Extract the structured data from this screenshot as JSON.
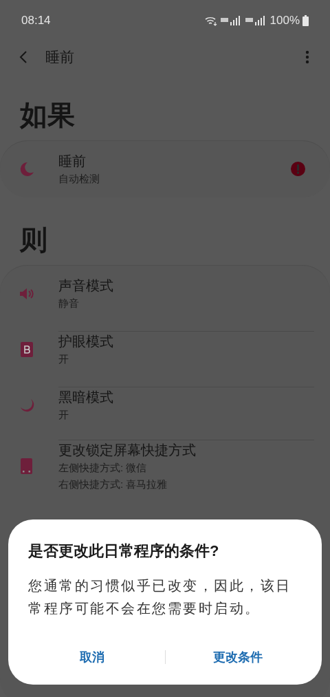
{
  "status_bar": {
    "time": "08:14",
    "battery": "100%"
  },
  "header": {
    "title": "睡前"
  },
  "sections": [
    {
      "heading": "如果",
      "items": [
        {
          "kind": "bedtime",
          "title": "睡前",
          "details": [
            "自动检测"
          ],
          "warning": true
        }
      ]
    },
    {
      "heading": "则",
      "items": [
        {
          "kind": "sound",
          "title": "声音模式",
          "details": [
            "静音"
          ],
          "warning": false
        },
        {
          "kind": "eye_comfort",
          "title": "护眼模式",
          "details": [
            "开"
          ],
          "warning": false
        },
        {
          "kind": "dark_mode",
          "title": "黑暗模式",
          "details": [
            "开"
          ],
          "warning": false
        },
        {
          "kind": "lock_shortcut",
          "title": "更改锁定屏幕快捷方式",
          "details": [
            "左侧快捷方式: 微信",
            "右侧快捷方式: 喜马拉雅"
          ],
          "warning": false
        }
      ]
    }
  ],
  "dialog": {
    "title": "是否更改此日常程序的条件?",
    "message": "您通常的习惯似乎已改变，因此，该日常程序可能不会在您需要时启动。",
    "buttons": [
      "取消",
      "更改条件"
    ]
  }
}
